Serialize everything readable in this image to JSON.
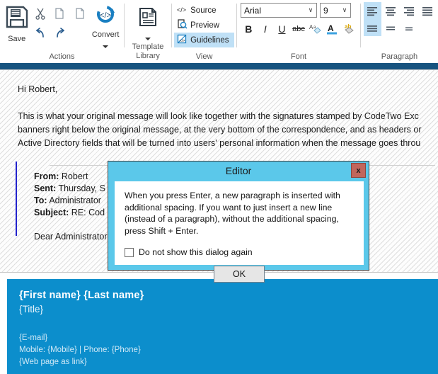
{
  "ribbon": {
    "groups": [
      {
        "name": "actions",
        "label": "Actions"
      },
      {
        "name": "template_library",
        "label": "Template\nLibrary"
      },
      {
        "name": "view",
        "label": "View"
      },
      {
        "name": "font",
        "label": "Font"
      },
      {
        "name": "paragraph",
        "label": "Paragraph"
      }
    ],
    "actions": {
      "label": "Actions",
      "save_label": "Save",
      "convert_label": "Convert",
      "cut_icon": "scissors-icon",
      "copy_icon": "copy-icon",
      "paste_icon": "paste-icon",
      "undo_icon": "undo-icon",
      "redo_icon": "redo-icon",
      "save_icon": "floppy-disk-icon",
      "convert_icon": "convert-code-icon",
      "caret": "▼"
    },
    "template_library": {
      "label_line1": "Template",
      "label_line2": "Library",
      "icon": "template-document-icon",
      "caret": "▼"
    },
    "view": {
      "label": "View",
      "items": [
        {
          "label": "Source",
          "icon": "source-code-icon",
          "selected": false
        },
        {
          "label": "Preview",
          "icon": "preview-magnifier-icon",
          "selected": false
        },
        {
          "label": "Guidelines",
          "icon": "guidelines-icon",
          "selected": true
        }
      ]
    },
    "font": {
      "label": "Font",
      "family_value": "Arial",
      "size_value": "9",
      "dropdown_arrow": "∨",
      "bold_label": "B",
      "italic_label": "I",
      "underline_label": "U",
      "strike_label": "abc",
      "clear_label": "A",
      "color_label": "A",
      "highlight_label": "ab"
    },
    "paragraph": {
      "label": "Paragraph",
      "align_left_selected": true,
      "line_spacing_selected": true
    }
  },
  "editor": {
    "greeting": "Hi Robert,",
    "paragraph_lines": [
      "This is what your original message will look like together with the signatures stamped by CodeTwo Exc",
      "banners right below the original message, at the very bottom of the correspondence, and as headers or",
      "Active Directory fields that will be turned into users' personal information when the message goes throu"
    ],
    "quoted": {
      "from_label": "From:",
      "from_value": "Robert",
      "sent_label": "Sent:",
      "sent_value": "Thursday, S",
      "to_label": "To:",
      "to_value": "Administrator",
      "subject_label": "Subject:",
      "subject_value": "RE: Cod",
      "salutation": "Dear Administrator"
    },
    "signature": {
      "name": "{First name} {Last name}",
      "title": "{Title}",
      "email": "{E-mail}",
      "phones": "Mobile:  {Mobile} | Phone: {Phone}",
      "web": "{Web page as link}",
      "background_color": "#0c8ecc"
    }
  },
  "dialog": {
    "title": "Editor",
    "close_label": "x",
    "message": "When you press Enter, a new paragraph is inserted with additional spacing. If you want to just insert a new line (instead of a paragraph), without the additional spacing, press Shift + Enter.",
    "checkbox_label": "Do not show this dialog again",
    "checkbox_checked": false,
    "ok_label": "OK",
    "titlebar_color": "#5bc8ea",
    "close_color": "#c1665c"
  },
  "colors": {
    "nav_bar": "#17537f",
    "selection_highlight": "#bfe0f6",
    "signature_blue": "#0c8ecc",
    "quote_bar": "#2222cc"
  }
}
